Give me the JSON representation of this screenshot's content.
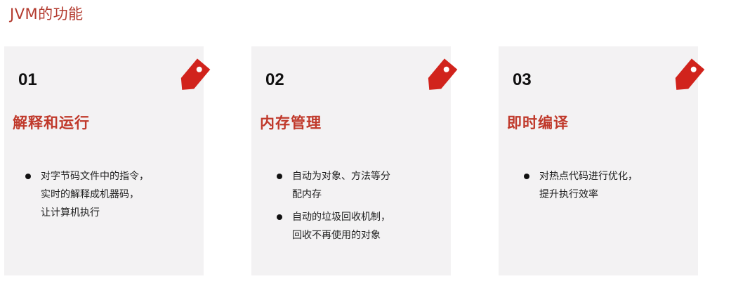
{
  "header": {
    "title": "JVM的功能"
  },
  "colors": {
    "accent": "#c0392b",
    "card_bg": "#f3f2f3",
    "tag": "#d1231c"
  },
  "cards": [
    {
      "number": "01",
      "title": "解释和运行",
      "icon": "price-tag-icon",
      "bullets": [
        "对字节码文件中的指令，\n实时的解释成机器码，\n让计算机执行"
      ]
    },
    {
      "number": "02",
      "title": "内存管理",
      "icon": "price-tag-icon",
      "bullets": [
        "自动为对象、方法等分\n配内存",
        "自动的垃圾回收机制，\n回收不再使用的对象"
      ]
    },
    {
      "number": "03",
      "title": "即时编译",
      "icon": "price-tag-icon",
      "bullets": [
        "对热点代码进行优化，\n提升执行效率"
      ]
    }
  ]
}
